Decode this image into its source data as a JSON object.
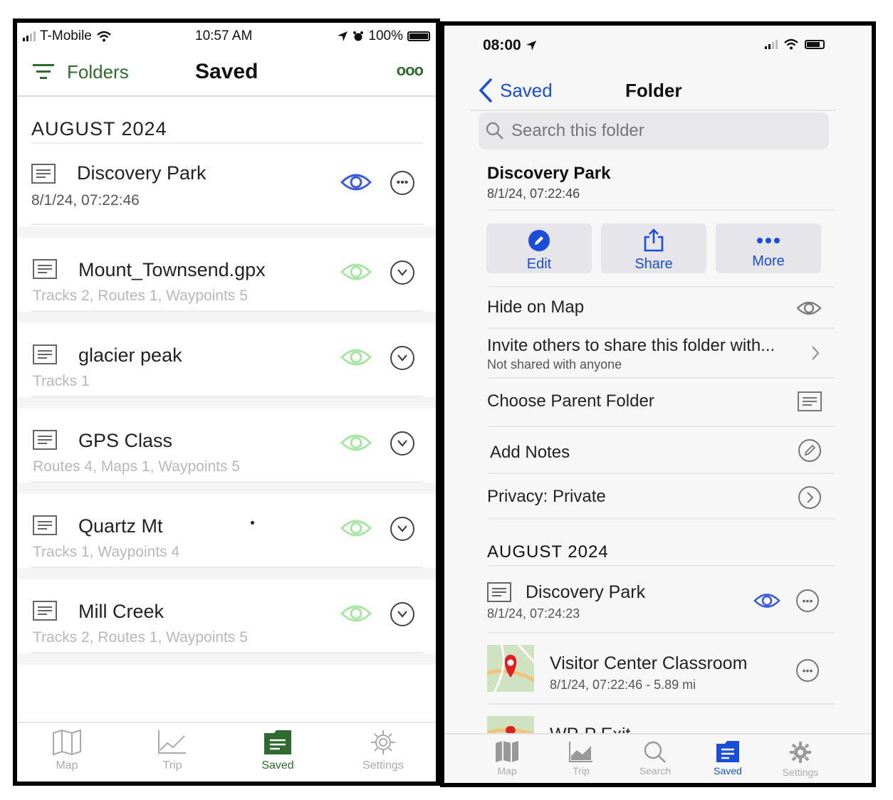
{
  "left": {
    "status": {
      "carrier": "T-Mobile",
      "time": "10:57 AM",
      "battery": "100%"
    },
    "nav": {
      "folders_label": "Folders",
      "title": "Saved",
      "more_glyph": "ooo"
    },
    "section": "AUGUST 2024",
    "folder_item": {
      "title": "Discovery Park",
      "sub": "8/1/24, 07:22:46"
    },
    "items": [
      {
        "title": "Mount_Townsend.gpx",
        "sub": "Tracks 2, Routes 1, Waypoints 5"
      },
      {
        "title": "glacier peak",
        "sub": "Tracks 1"
      },
      {
        "title": "GPS Class",
        "sub": "Routes 4, Maps 1, Waypoints 5"
      },
      {
        "title": "Quartz Mt",
        "sub": "Tracks 1, Waypoints 4"
      },
      {
        "title": "Mill Creek",
        "sub": "Tracks 2, Routes 1, Waypoints 5"
      }
    ],
    "tabs": [
      "Map",
      "Trip",
      "Saved",
      "Settings"
    ],
    "colors": {
      "accent": "#2e6b2e",
      "eye_green": "#a8e6a3",
      "eye_blue": "#3b5bdb"
    }
  },
  "right": {
    "status": {
      "time": "08:00"
    },
    "nav": {
      "back_label": "Saved",
      "title": "Folder"
    },
    "search": {
      "placeholder": "Search this folder"
    },
    "header": {
      "title": "Discovery Park",
      "sub": "8/1/24, 07:22:46"
    },
    "actions": [
      {
        "label": "Edit",
        "icon": "pencil-icon"
      },
      {
        "label": "Share",
        "icon": "share-icon"
      },
      {
        "label": "More",
        "icon": "more-icon"
      }
    ],
    "rows": {
      "hide": "Hide on Map",
      "invite": "Invite others to share this folder with...",
      "invite_sub": "Not shared with anyone",
      "parent": "Choose Parent Folder",
      "notes": "Add Notes",
      "privacy": "Privacy: Private"
    },
    "section": "AUGUST 2024",
    "list": [
      {
        "title": "Discovery Park",
        "sub": "8/1/24, 07:24:23"
      },
      {
        "title": "Visitor Center Classroom",
        "sub": "8/1/24, 07:22:46 - 5.89 mi"
      },
      {
        "title": "WP-P Exit",
        "sub": ""
      }
    ],
    "tabs": [
      "Map",
      "Trip",
      "Search",
      "Saved",
      "Settings"
    ],
    "colors": {
      "accent": "#1a4ed8"
    }
  }
}
